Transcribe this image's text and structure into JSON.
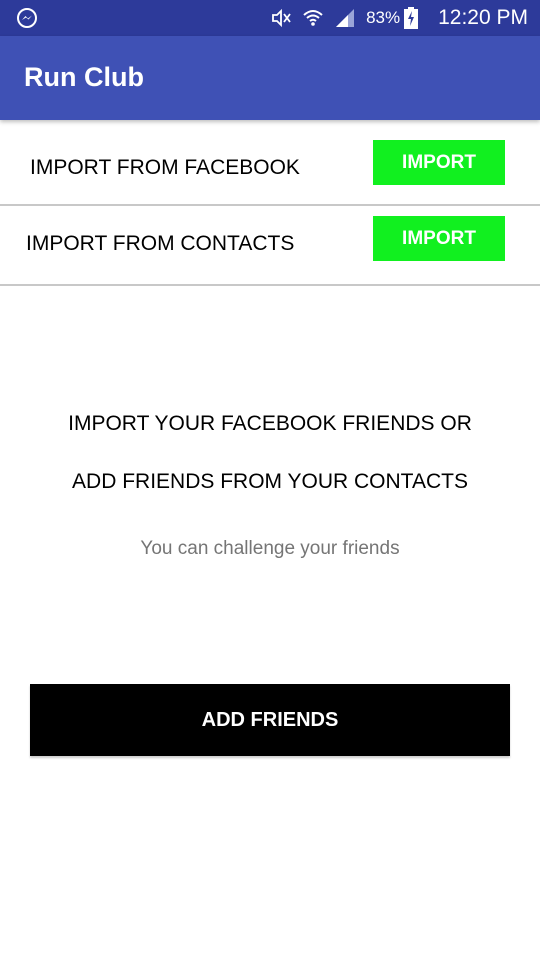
{
  "status_bar": {
    "battery_percent": "83%",
    "time": "12:20 PM",
    "icons": [
      "messenger-icon",
      "mute-icon",
      "wifi-icon",
      "signal-icon",
      "battery-charging-icon"
    ]
  },
  "app_bar": {
    "title": "Run Club"
  },
  "import_rows": [
    {
      "label": "IMPORT FROM FACEBOOK",
      "button_label": "IMPORT"
    },
    {
      "label": "IMPORT FROM CONTACTS",
      "button_label": "IMPORT"
    }
  ],
  "empty_state": {
    "line1": "IMPORT YOUR FACEBOOK FRIENDS OR",
    "line2": "ADD FRIENDS FROM YOUR CONTACTS",
    "subtext": "You can challenge your friends"
  },
  "add_friends_button": {
    "label": "ADD FRIENDS"
  },
  "colors": {
    "status_bar": "#2d3a9a",
    "app_bar": "#3f51b5",
    "import_button": "#11f01f",
    "add_button": "#000000"
  }
}
